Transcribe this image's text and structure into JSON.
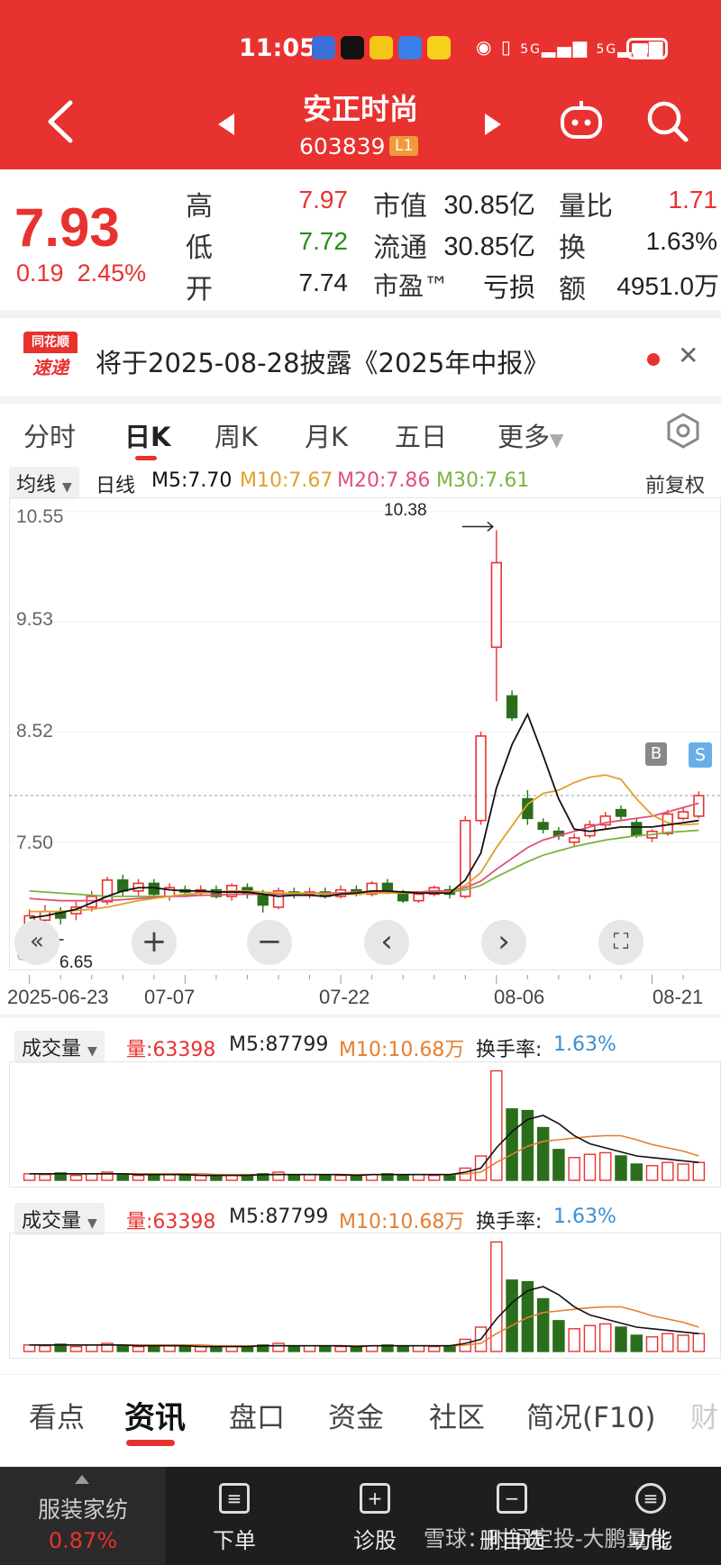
{
  "status_bar": {
    "time": "11:05",
    "signal1": "5G",
    "signal2": "5G"
  },
  "header": {
    "stock_name": "安正时尚",
    "stock_code": "603839",
    "level_badge": "L1"
  },
  "quote": {
    "price": "7.93",
    "change": "0.19",
    "change_pct": "2.45%",
    "high_label": "高",
    "high": "7.97",
    "low_label": "低",
    "low": "7.72",
    "open_label": "开",
    "open": "7.74",
    "mktcap_label": "市值",
    "mktcap": "30.85亿",
    "float_label": "流通",
    "float": "30.85亿",
    "pe_label": "市盈™",
    "pe": "亏损",
    "volratio_label": "量比",
    "volratio": "1.71",
    "turnover_label": "换",
    "turnover": "1.63%",
    "amount_label": "额",
    "amount": "4951.0万"
  },
  "notice": {
    "logo_top": "同花顺",
    "logo_bottom": "速递",
    "text": "将于2025-08-28披露《2025年中报》"
  },
  "kline_tabs": [
    "分时",
    "日K",
    "周K",
    "月K",
    "五日",
    "更多"
  ],
  "ma_bar": {
    "selector": "均线",
    "period": "日线",
    "m5": "M5:7.70",
    "m10": "M10:7.67",
    "m20": "M20:7.86",
    "m30": "M30:7.61",
    "adjust": "前复权"
  },
  "chart_data": {
    "type": "candlestick",
    "y_ticks": [
      "10.55",
      "9.53",
      "8.52",
      "7.50",
      "6.48"
    ],
    "ylim": [
      6.4,
      10.6
    ],
    "high_annotation": "10.38",
    "low_annotation": "6.65",
    "x_ticks": [
      "2025-06-23",
      "07-07",
      "07-22",
      "08-06",
      "08-21"
    ],
    "candles": [
      {
        "o": 6.72,
        "c": 6.82,
        "h": 6.88,
        "l": 6.65
      },
      {
        "o": 6.78,
        "c": 6.86,
        "h": 6.92,
        "l": 6.7
      },
      {
        "o": 6.86,
        "c": 6.8,
        "h": 6.9,
        "l": 6.74
      },
      {
        "o": 6.84,
        "c": 6.9,
        "h": 6.95,
        "l": 6.78
      },
      {
        "o": 6.9,
        "c": 7.0,
        "h": 7.05,
        "l": 6.86
      },
      {
        "o": 6.95,
        "c": 7.15,
        "h": 7.18,
        "l": 6.92
      },
      {
        "o": 7.15,
        "c": 7.05,
        "h": 7.2,
        "l": 7.0
      },
      {
        "o": 7.05,
        "c": 7.12,
        "h": 7.16,
        "l": 7.0
      },
      {
        "o": 7.12,
        "c": 7.02,
        "h": 7.16,
        "l": 6.98
      },
      {
        "o": 7.0,
        "c": 7.08,
        "h": 7.12,
        "l": 6.96
      },
      {
        "o": 7.06,
        "c": 7.04,
        "h": 7.1,
        "l": 7.0
      },
      {
        "o": 7.04,
        "c": 7.06,
        "h": 7.1,
        "l": 7.0
      },
      {
        "o": 7.06,
        "c": 7.0,
        "h": 7.1,
        "l": 6.98
      },
      {
        "o": 7.0,
        "c": 7.1,
        "h": 7.12,
        "l": 6.96
      },
      {
        "o": 7.08,
        "c": 7.02,
        "h": 7.12,
        "l": 6.98
      },
      {
        "o": 7.02,
        "c": 6.92,
        "h": 7.06,
        "l": 6.85
      },
      {
        "o": 6.9,
        "c": 7.05,
        "h": 7.08,
        "l": 6.88
      },
      {
        "o": 7.04,
        "c": 7.02,
        "h": 7.08,
        "l": 6.98
      },
      {
        "o": 7.02,
        "c": 7.04,
        "h": 7.08,
        "l": 6.98
      },
      {
        "o": 7.04,
        "c": 7.0,
        "h": 7.08,
        "l": 6.98
      },
      {
        "o": 7.0,
        "c": 7.06,
        "h": 7.1,
        "l": 6.98
      },
      {
        "o": 7.06,
        "c": 7.02,
        "h": 7.1,
        "l": 7.0
      },
      {
        "o": 7.02,
        "c": 7.12,
        "h": 7.14,
        "l": 7.0
      },
      {
        "o": 7.12,
        "c": 7.04,
        "h": 7.16,
        "l": 7.02
      },
      {
        "o": 7.04,
        "c": 6.96,
        "h": 7.06,
        "l": 6.94
      },
      {
        "o": 6.96,
        "c": 7.02,
        "h": 7.04,
        "l": 6.94
      },
      {
        "o": 7.02,
        "c": 7.08,
        "h": 7.1,
        "l": 7.0
      },
      {
        "o": 7.06,
        "c": 7.02,
        "h": 7.1,
        "l": 6.98
      },
      {
        "o": 7.0,
        "c": 7.7,
        "h": 7.74,
        "l": 6.98
      },
      {
        "o": 7.7,
        "c": 8.48,
        "h": 8.52,
        "l": 7.66
      },
      {
        "o": 9.3,
        "c": 10.08,
        "h": 10.38,
        "l": 8.8
      },
      {
        "o": 8.85,
        "c": 8.65,
        "h": 8.9,
        "l": 8.62
      },
      {
        "o": 7.9,
        "c": 7.72,
        "h": 7.98,
        "l": 7.66
      },
      {
        "o": 7.68,
        "c": 7.62,
        "h": 7.72,
        "l": 7.58
      },
      {
        "o": 7.6,
        "c": 7.56,
        "h": 7.64,
        "l": 7.52
      },
      {
        "o": 7.5,
        "c": 7.54,
        "h": 7.58,
        "l": 7.46
      },
      {
        "o": 7.56,
        "c": 7.66,
        "h": 7.7,
        "l": 7.54
      },
      {
        "o": 7.66,
        "c": 7.74,
        "h": 7.78,
        "l": 7.62
      },
      {
        "o": 7.8,
        "c": 7.74,
        "h": 7.84,
        "l": 7.7
      },
      {
        "o": 7.68,
        "c": 7.56,
        "h": 7.72,
        "l": 7.54
      },
      {
        "o": 7.54,
        "c": 7.6,
        "h": 7.62,
        "l": 7.5
      },
      {
        "o": 7.58,
        "c": 7.76,
        "h": 7.8,
        "l": 7.56
      },
      {
        "o": 7.72,
        "c": 7.78,
        "h": 7.82,
        "l": 7.7
      },
      {
        "o": 7.74,
        "c": 7.93,
        "h": 7.97,
        "l": 7.72
      }
    ],
    "ma5": [
      6.8,
      6.82,
      6.85,
      6.88,
      6.94,
      7.0,
      7.05,
      7.08,
      7.08,
      7.06,
      7.05,
      7.05,
      7.04,
      7.04,
      7.04,
      7.02,
      7.0,
      7.01,
      7.01,
      7.0,
      7.02,
      7.03,
      7.05,
      7.05,
      7.04,
      7.03,
      7.03,
      7.03,
      7.15,
      7.4,
      8.0,
      8.4,
      8.68,
      8.3,
      7.9,
      7.62,
      7.6,
      7.62,
      7.64,
      7.64,
      7.64,
      7.66,
      7.68,
      7.7
    ],
    "ma10": [
      6.86,
      6.86,
      6.86,
      6.87,
      6.88,
      6.9,
      6.93,
      6.96,
      6.98,
      7.0,
      7.02,
      7.03,
      7.04,
      7.05,
      7.05,
      7.04,
      7.03,
      7.03,
      7.03,
      7.02,
      7.02,
      7.02,
      7.03,
      7.03,
      7.03,
      7.03,
      7.03,
      7.04,
      7.1,
      7.22,
      7.45,
      7.65,
      7.85,
      7.95,
      7.98,
      8.05,
      8.1,
      8.12,
      8.08,
      7.9,
      7.75,
      7.68,
      7.66,
      7.67
    ],
    "ma20": [
      6.98,
      6.97,
      6.96,
      6.96,
      6.96,
      6.96,
      6.97,
      6.98,
      6.99,
      7.0,
      7.0,
      7.01,
      7.01,
      7.02,
      7.02,
      7.02,
      7.02,
      7.03,
      7.03,
      7.03,
      7.03,
      7.04,
      7.04,
      7.04,
      7.04,
      7.04,
      7.05,
      7.05,
      7.08,
      7.14,
      7.25,
      7.35,
      7.45,
      7.52,
      7.56,
      7.6,
      7.64,
      7.68,
      7.7,
      7.72,
      7.74,
      7.78,
      7.82,
      7.86
    ],
    "ma30": [
      7.05,
      7.04,
      7.03,
      7.02,
      7.01,
      7.0,
      7.0,
      7.0,
      7.0,
      7.0,
      7.01,
      7.01,
      7.01,
      7.02,
      7.02,
      7.02,
      7.02,
      7.02,
      7.03,
      7.03,
      7.03,
      7.03,
      7.03,
      7.03,
      7.04,
      7.04,
      7.04,
      7.04,
      7.06,
      7.1,
      7.18,
      7.25,
      7.32,
      7.38,
      7.42,
      7.46,
      7.49,
      7.52,
      7.54,
      7.56,
      7.57,
      7.59,
      7.6,
      7.61
    ],
    "volume_panels": [
      {
        "title": "成交量",
        "vol": "量:63398",
        "m5": "M5:87799",
        "m10": "M10:10.68万",
        "turnover_label": "换手率:",
        "turnover": "1.63%"
      },
      {
        "title": "成交量",
        "vol": "量:63398",
        "m5": "M5:87799",
        "m10": "M10:10.68万",
        "turnover_label": "换手率:",
        "turnover": "1.63%"
      }
    ],
    "volumes": [
      8,
      7,
      9,
      6,
      8,
      10,
      7,
      6,
      6,
      7,
      6,
      6,
      6,
      7,
      6,
      8,
      10,
      6,
      7,
      6,
      6,
      6,
      7,
      8,
      6,
      7,
      6,
      7,
      15,
      30,
      135,
      88,
      86,
      65,
      38,
      28,
      32,
      34,
      30,
      20,
      18,
      22,
      20,
      22
    ],
    "vol_ma5": [
      8,
      8,
      8,
      8,
      8,
      8,
      8,
      7,
      7,
      7,
      7,
      6,
      6,
      6,
      6,
      7,
      7,
      7,
      7,
      7,
      7,
      6,
      7,
      7,
      7,
      7,
      7,
      7,
      10,
      15,
      40,
      60,
      75,
      80,
      70,
      55,
      45,
      40,
      35,
      30,
      28,
      26,
      24,
      22
    ],
    "vol_ma10": [
      8,
      8,
      8,
      8,
      8,
      8,
      8,
      8,
      8,
      8,
      8,
      8,
      7,
      7,
      7,
      7,
      7,
      7,
      7,
      7,
      7,
      7,
      7,
      7,
      7,
      7,
      7,
      7,
      8,
      10,
      22,
      32,
      42,
      48,
      50,
      52,
      54,
      55,
      55,
      50,
      44,
      40,
      36,
      30
    ]
  },
  "controls": {
    "zoom_in": "+",
    "zoom_out": "−",
    "prev": "‹",
    "next": "›"
  },
  "markers": {
    "b": "B",
    "s": "S"
  },
  "bottom_tabs": [
    "看点",
    "资讯",
    "盘口",
    "资金",
    "社区",
    "简况(F10)",
    "财"
  ],
  "footer": {
    "sector_name": "服装家纺",
    "sector_pct": "0.87%",
    "items": [
      "下单",
      "诊股",
      "删自选",
      "功能"
    ],
    "watermark": "雪球：时间定投-大鹏量化"
  },
  "colors": {
    "up": "#e8322f",
    "down": "#2a6e1c",
    "ma5": "#111111",
    "ma10": "#e0a02a",
    "ma20": "#e0507a",
    "ma30": "#7cb342",
    "turnover": "#3a8fd6"
  }
}
